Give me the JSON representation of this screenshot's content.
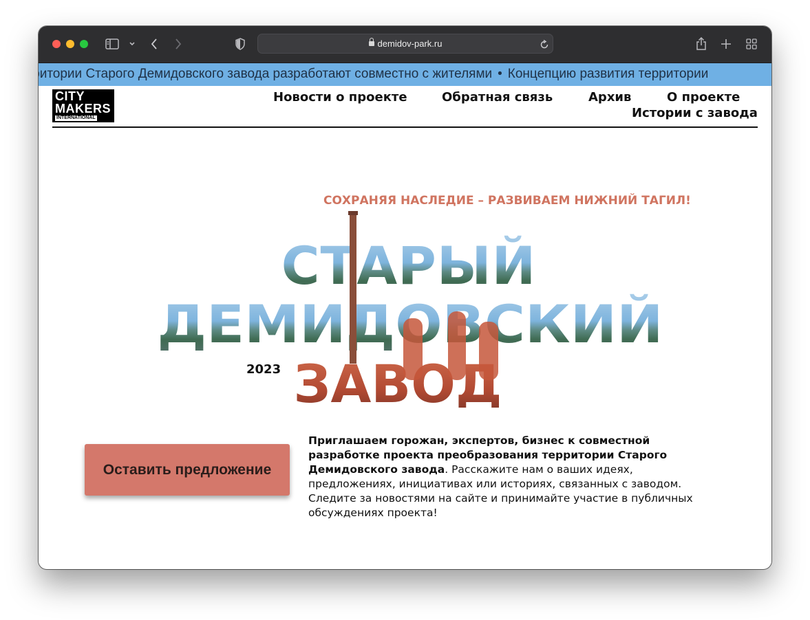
{
  "browser": {
    "url": "demidov-park.ru",
    "icons": [
      "sidebar-icon",
      "chevron-down-icon",
      "back-icon",
      "forward-icon",
      "shield-icon",
      "lock-icon",
      "reload-icon",
      "share-icon",
      "new-tab-icon",
      "tab-overview-icon"
    ]
  },
  "ticker": {
    "item1": "ерритории Старого Демидовского завода разработают совместно с жителями",
    "separator": "•",
    "item2": "Концепцию развития территории"
  },
  "logo": {
    "line1": "CITY",
    "line2": "MAKERS",
    "line3": "INTERNATIONAL"
  },
  "nav": {
    "news": "Новости о проекте",
    "feedback": "Обратная связь",
    "archive": "Архив",
    "about": "О проекте",
    "stories": "Истории с завода"
  },
  "hero": {
    "tagline": "СОХРАНЯЯ НАСЛЕДИЕ – РАЗВИВАЕМ НИЖНИЙ ТАГИЛ!",
    "line1": "СТАРЫЙ",
    "line2": "ДЕМИДОВСКИЙ",
    "line3": "ЗАВОД",
    "year": "2023"
  },
  "cta": {
    "button_label": "Оставить предложение"
  },
  "intro": {
    "bold": "Приглашаем горожан, экспертов, бизнес к совместной разработке проекта преобразования территории Старого Демидовского завода",
    "rest": ". Расскажите нам о ваших идеях, предложениях, инициативах или историях, связанных с заводом. Следите за новостями на сайте и принимайте участие в публичных обсуждениях проекта!"
  },
  "colors": {
    "ticker_bg": "#6fb0e4",
    "accent": "#d07460",
    "button": "#d4786b"
  }
}
